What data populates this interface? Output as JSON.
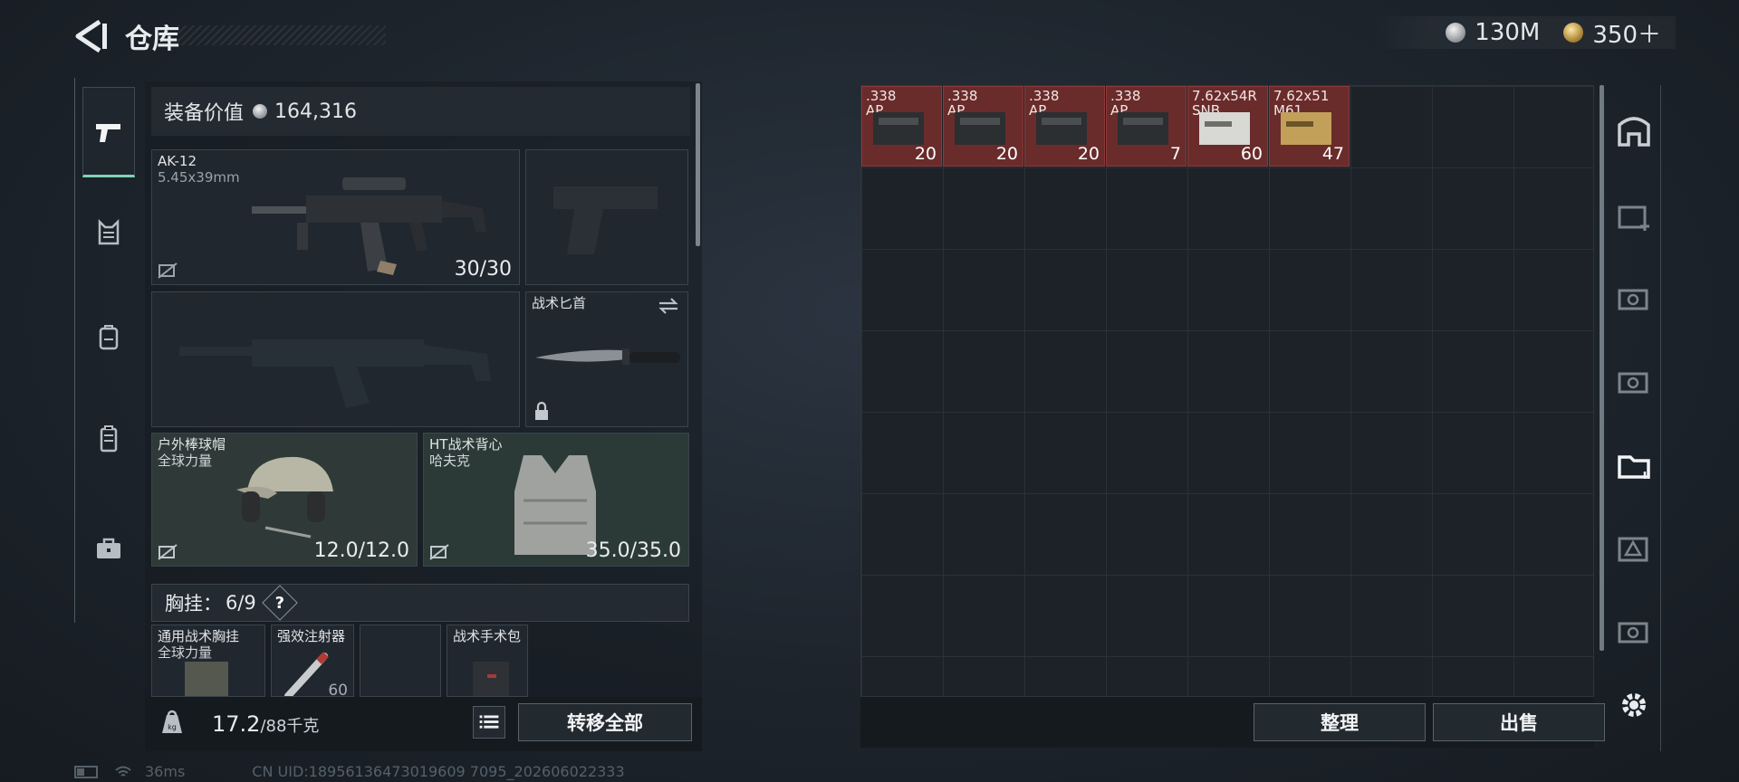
{
  "header": {
    "title": "仓库",
    "currency_silver": "130M",
    "currency_gold": "350＋"
  },
  "equipment": {
    "value_label": "装备价值",
    "value": "164,316",
    "primary": {
      "name": "AK-12",
      "caliber": "5.45x39mm",
      "ammo": "30/30"
    },
    "knife": {
      "name": "战术匕首"
    },
    "helmet": {
      "name": "户外棒球帽",
      "sub": "全球力量",
      "durability": "12.0/12.0"
    },
    "vest": {
      "name": "HT战术背心",
      "sub": "哈夫克",
      "durability": "35.0/35.0"
    },
    "chest_label": "胸挂：",
    "chest_count": "6/9",
    "help": "?",
    "chest_items": [
      {
        "name": "通用战术胸挂",
        "sub": "全球力量"
      },
      {
        "name": "强效注射器",
        "sub": ""
      },
      {
        "name": "",
        "sub": ""
      },
      {
        "name": "战术手术包",
        "sub": ""
      }
    ],
    "partial_value": "60"
  },
  "footer": {
    "weight": "17.2",
    "weight_max": "/88千克",
    "transfer_all": "转移全部",
    "organize": "整理",
    "sell": "出售"
  },
  "storage": {
    "items": [
      {
        "name": ".338\nAP",
        "count": "20"
      },
      {
        "name": ".338\nAP",
        "count": "20"
      },
      {
        "name": ".338\nAP",
        "count": "20"
      },
      {
        "name": ".338\nAP",
        "count": "7"
      },
      {
        "name": "7.62x54R\nSNB",
        "count": "60"
      },
      {
        "name": "7.62x51\nM61",
        "count": "47"
      }
    ]
  },
  "status": {
    "ping": "36ms",
    "uid": "CN UID:18956136473019609 7095_202606022333"
  },
  "colors": {
    "accent": "#7fd3b4",
    "ammo_slot": "#6a2b2b"
  }
}
